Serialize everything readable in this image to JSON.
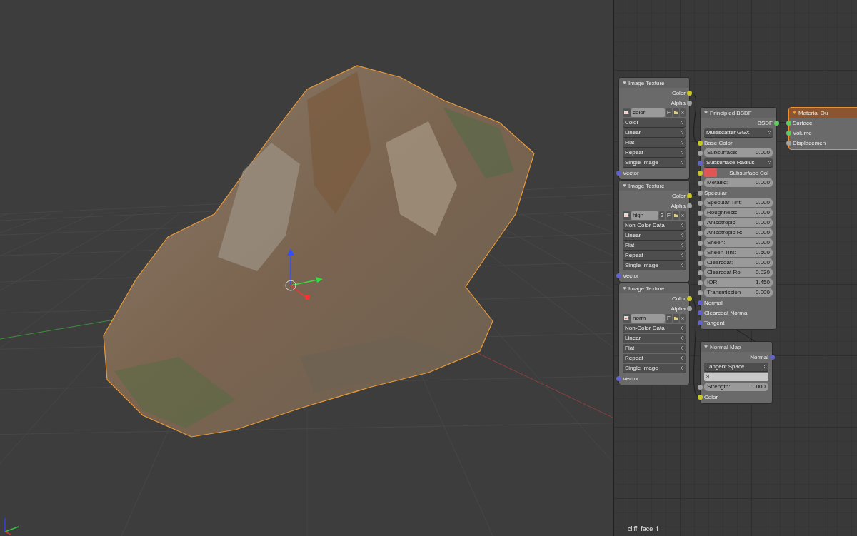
{
  "node_editor": {
    "material_name": "cliff_face_f",
    "nodes": [
      {
        "title": "Image Texture",
        "kind": "texture",
        "selected": false,
        "rows": [
          {
            "kind": "output",
            "label": "Color",
            "socket": {
              "color": "#c7c729"
            }
          },
          {
            "kind": "output",
            "label": "Alpha",
            "socket": {
              "color": "#a1a1a1"
            }
          },
          {
            "kind": "image",
            "name": "color",
            "fake_user": "F"
          },
          {
            "kind": "dropdown",
            "value": "Color"
          },
          {
            "kind": "dropdown",
            "value": "Linear"
          },
          {
            "kind": "dropdown",
            "value": "Flat"
          },
          {
            "kind": "dropdown",
            "value": "Repeat"
          },
          {
            "kind": "dropdown",
            "value": "Single Image"
          },
          {
            "kind": "input",
            "label": "Vector",
            "socket": {
              "color": "#6363c7"
            }
          }
        ]
      },
      {
        "title": "Image Texture",
        "kind": "texture",
        "selected": false,
        "rows": [
          {
            "kind": "output",
            "label": "Color",
            "socket": {
              "color": "#c7c729"
            }
          },
          {
            "kind": "output",
            "label": "Alpha",
            "socket": {
              "color": "#a1a1a1"
            }
          },
          {
            "kind": "image",
            "name": "high",
            "users": "2",
            "fake_user": "F"
          },
          {
            "kind": "dropdown",
            "value": "Non-Color Data"
          },
          {
            "kind": "dropdown",
            "value": "Linear"
          },
          {
            "kind": "dropdown",
            "value": "Flat"
          },
          {
            "kind": "dropdown",
            "value": "Repeat"
          },
          {
            "kind": "dropdown",
            "value": "Single Image"
          },
          {
            "kind": "input",
            "label": "Vector",
            "socket": {
              "color": "#6363c7"
            }
          }
        ]
      },
      {
        "title": "Image Texture",
        "kind": "texture",
        "selected": false,
        "rows": [
          {
            "kind": "output",
            "label": "Color",
            "socket": {
              "color": "#c7c729"
            }
          },
          {
            "kind": "output",
            "label": "Alpha",
            "socket": {
              "color": "#a1a1a1"
            }
          },
          {
            "kind": "image",
            "name": "norm",
            "fake_user": "F"
          },
          {
            "kind": "dropdown",
            "value": "Non-Color Data"
          },
          {
            "kind": "dropdown",
            "value": "Linear"
          },
          {
            "kind": "dropdown",
            "value": "Flat"
          },
          {
            "kind": "dropdown",
            "value": "Repeat"
          },
          {
            "kind": "dropdown",
            "value": "Single Image"
          },
          {
            "kind": "input",
            "label": "Vector",
            "socket": {
              "color": "#6363c7"
            }
          }
        ]
      },
      {
        "title": "Principled BSDF",
        "kind": "shader",
        "selected": false,
        "rows": [
          {
            "kind": "output",
            "label": "BSDF",
            "socket": {
              "color": "#63c763"
            }
          },
          {
            "kind": "dropdown",
            "value": "Multiscatter GGX"
          },
          {
            "kind": "input",
            "label": "Base Color",
            "socket": {
              "color": "#c7c729"
            }
          },
          {
            "kind": "slider",
            "label": "Subsurface:",
            "value": "0.000",
            "socket": {
              "color": "#a1a1a1"
            }
          },
          {
            "kind": "dropdown",
            "value": "Subsurface Radius",
            "socket": {
              "color": "#6363c7"
            }
          },
          {
            "kind": "color",
            "label": "Subsurface Col",
            "color": "#e05555",
            "socket": {
              "color": "#c7c729"
            }
          },
          {
            "kind": "slider",
            "label": "Metallic:",
            "value": "0.000",
            "socket": {
              "color": "#a1a1a1"
            }
          },
          {
            "kind": "input",
            "label": "Specular",
            "socket": {
              "color": "#a1a1a1"
            }
          },
          {
            "kind": "slider",
            "label": "Specular Tint:",
            "value": "0.000",
            "socket": {
              "color": "#a1a1a1"
            }
          },
          {
            "kind": "slider",
            "label": "Roughness:",
            "value": "0.000",
            "socket": {
              "color": "#a1a1a1"
            }
          },
          {
            "kind": "slider",
            "label": "Anisotropic:",
            "value": "0.000",
            "socket": {
              "color": "#a1a1a1"
            }
          },
          {
            "kind": "slider",
            "label": "Anisotropic R:",
            "value": "0.000",
            "socket": {
              "color": "#a1a1a1"
            }
          },
          {
            "kind": "slider",
            "label": "Sheen:",
            "value": "0.000",
            "socket": {
              "color": "#a1a1a1"
            }
          },
          {
            "kind": "slider",
            "label": "Sheen Tint:",
            "value": "0.500",
            "socket": {
              "color": "#a1a1a1"
            }
          },
          {
            "kind": "slider",
            "label": "Clearcoat:",
            "value": "0.000",
            "socket": {
              "color": "#a1a1a1"
            }
          },
          {
            "kind": "slider",
            "label": "Clearcoat Ro",
            "value": "0.030",
            "socket": {
              "color": "#a1a1a1"
            }
          },
          {
            "kind": "slider",
            "label": "IOR:",
            "value": "1.450",
            "socket": {
              "color": "#a1a1a1"
            }
          },
          {
            "kind": "slider",
            "label": "Transmission",
            "value": "0.000",
            "socket": {
              "color": "#a1a1a1"
            }
          },
          {
            "kind": "input",
            "label": "Normal",
            "socket": {
              "color": "#6363c7"
            }
          },
          {
            "kind": "input",
            "label": "Clearcoat Normal",
            "socket": {
              "color": "#6363c7"
            }
          },
          {
            "kind": "input",
            "label": "Tangent",
            "socket": {
              "color": "#6363c7"
            }
          }
        ]
      },
      {
        "title": "Normal Map",
        "kind": "vector",
        "selected": false,
        "rows": [
          {
            "kind": "output",
            "label": "Normal",
            "socket": {
              "color": "#6363c7"
            }
          },
          {
            "kind": "dropdown",
            "value": "Tangent Space"
          },
          {
            "kind": "uv_field"
          },
          {
            "kind": "slider",
            "label": "Strength:",
            "value": "1.000",
            "socket": {
              "color": "#a1a1a1"
            }
          },
          {
            "kind": "input",
            "label": "Color",
            "socket": {
              "color": "#c7c729"
            }
          }
        ]
      },
      {
        "title": "Material Ou",
        "kind": "output",
        "selected": true,
        "rows": [
          {
            "kind": "input",
            "label": "Surface",
            "socket": {
              "color": "#63c763"
            }
          },
          {
            "kind": "input",
            "label": "Volume",
            "socket": {
              "color": "#63c763"
            }
          },
          {
            "kind": "input",
            "label": "Displacemen",
            "socket": {
              "color": "#a1a1a1"
            }
          }
        ]
      }
    ]
  }
}
